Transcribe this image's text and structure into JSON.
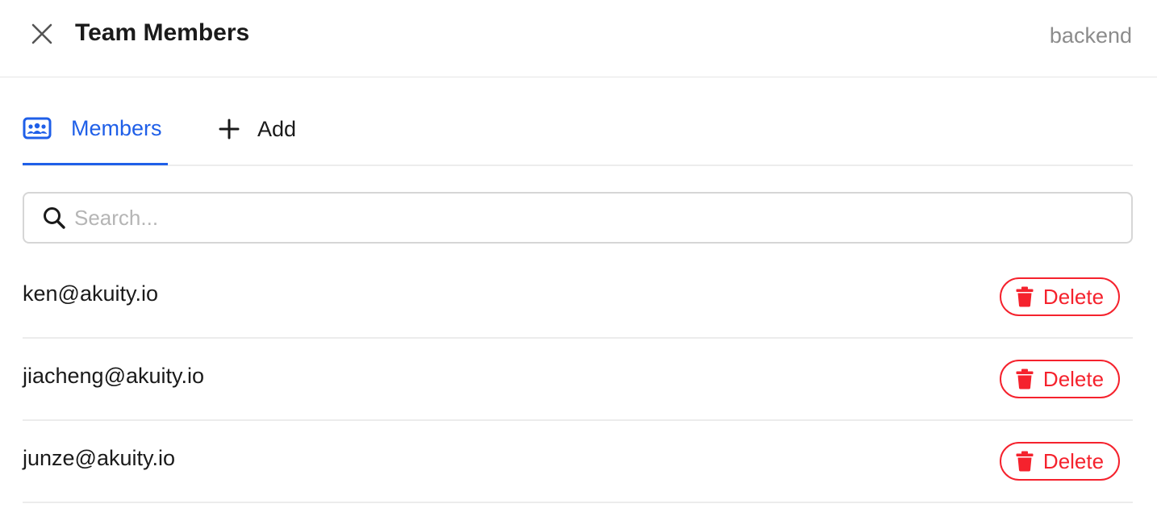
{
  "header": {
    "title": "Team Members",
    "team_name": "backend",
    "close_icon": "close-icon"
  },
  "tabs": [
    {
      "label": "Members",
      "icon": "team-icon",
      "active": true
    },
    {
      "label": "Add",
      "icon": "plus-icon",
      "active": false
    }
  ],
  "search": {
    "placeholder": "Search...",
    "value": "",
    "icon": "search-icon"
  },
  "members": [
    {
      "email": "ken@akuity.io",
      "action_label": "Delete"
    },
    {
      "email": "jiacheng@akuity.io",
      "action_label": "Delete"
    },
    {
      "email": "junze@akuity.io",
      "action_label": "Delete"
    }
  ],
  "colors": {
    "accent": "#1f5fe8",
    "danger": "#f5222d",
    "muted": "#8c8c8c"
  }
}
